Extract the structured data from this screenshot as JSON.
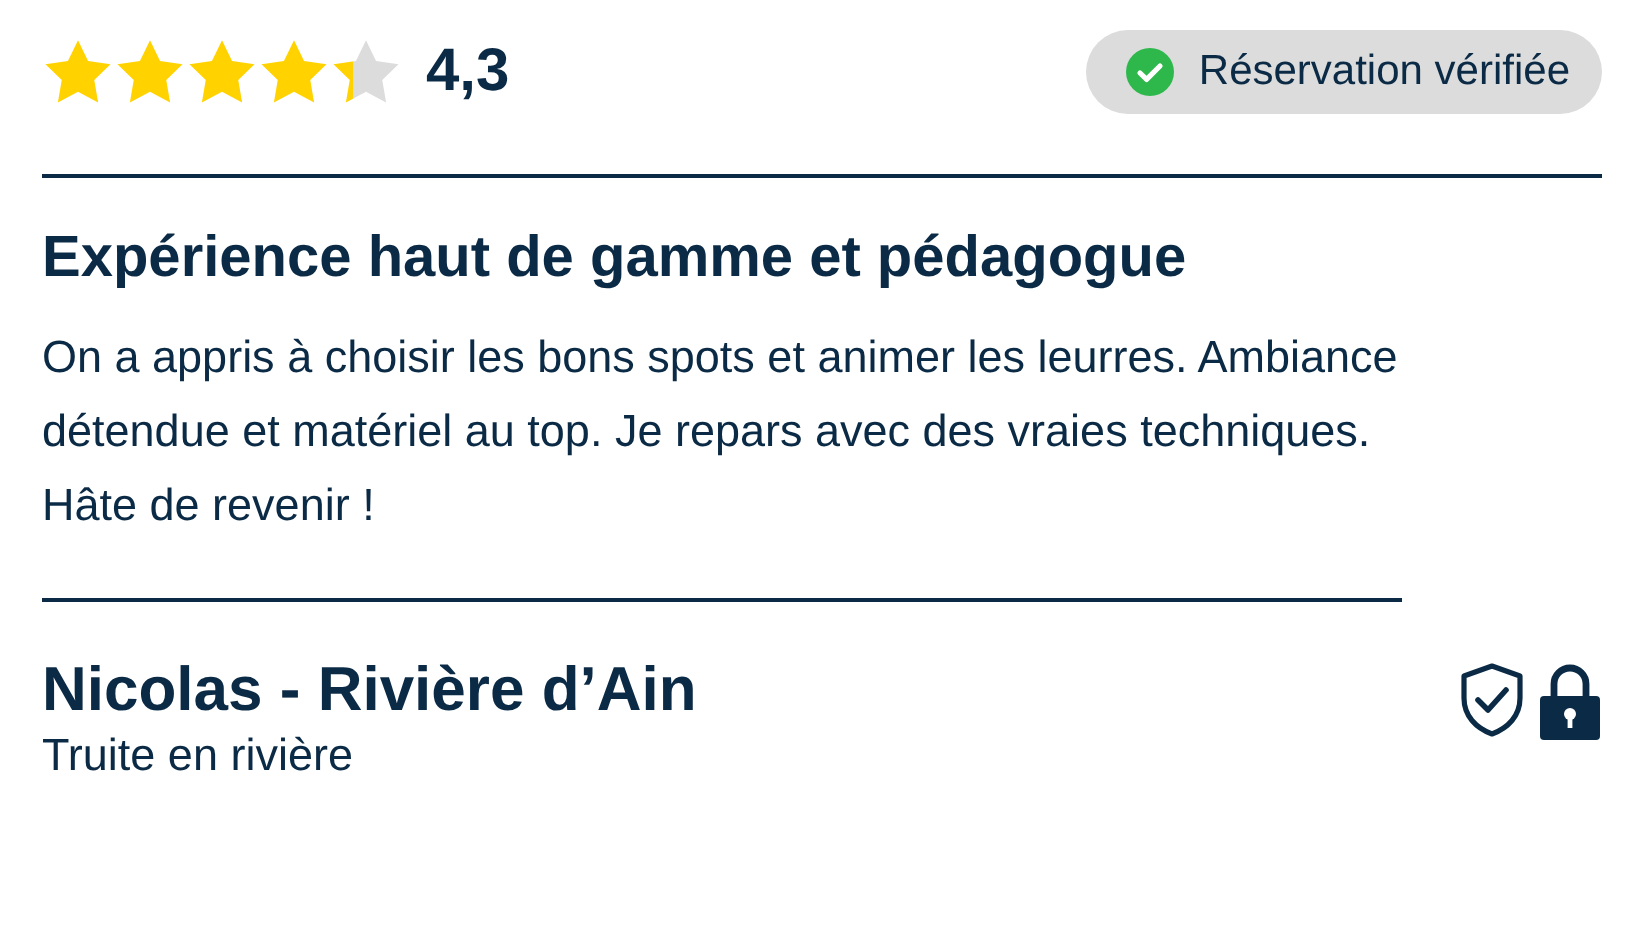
{
  "rating": {
    "stars": 4.3,
    "value": "4,3"
  },
  "badge": {
    "label": "Réservation vérifiée",
    "verified": true
  },
  "review": {
    "title": "Expérience haut de gamme et pédagogue",
    "body": "On a appris à choisir les bons spots et animer les leurres. Ambiance détendue et matériel au top. Je repars avec des vraies techniques.\nHâte de revenir !"
  },
  "author": {
    "name": "Nicolas - Rivière d’Ain",
    "trip": "Truite en rivière",
    "secured": true
  }
}
